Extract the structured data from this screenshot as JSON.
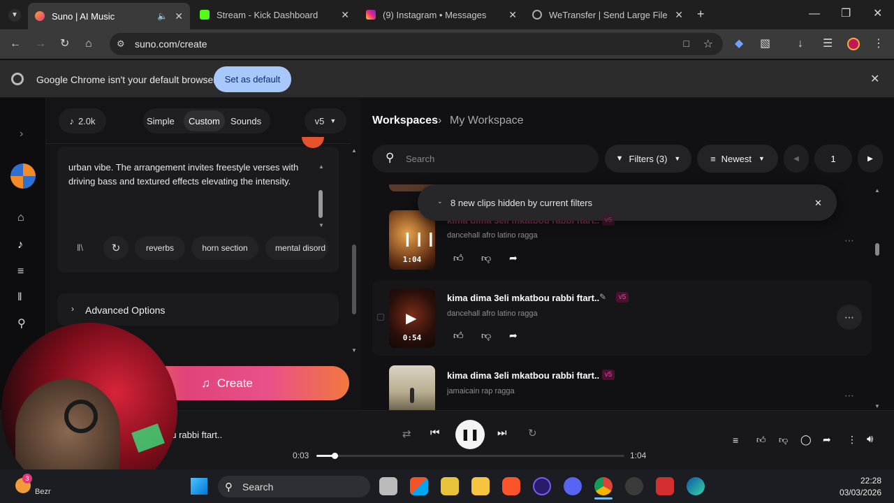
{
  "browser": {
    "tabs": [
      {
        "title": "Suno | AI Music",
        "color": "#f06a3b"
      },
      {
        "title": "Stream - Kick Dashboard",
        "color": "#53fc18"
      },
      {
        "title": "(9) Instagram • Messages",
        "color": "#d6249f"
      },
      {
        "title": "WeTransfer | Send Large Files Fa",
        "color": "#8a8a8a"
      }
    ],
    "url": "suno.com/create",
    "infobar_text": "Google Chrome isn't your default browser",
    "set_default_label": "Set as default"
  },
  "left_panel": {
    "credits": "2.0k",
    "modes": [
      "Simple",
      "Custom",
      "Sounds"
    ],
    "active_mode": "Custom",
    "version": "v5",
    "style_text": "urban vibe. The arrangement invites freestyle verses with driving bass and textured effects elevating the intensity.",
    "chips": [
      "reverbs",
      "horn section",
      "mental disord"
    ],
    "advanced_label": "Advanced Options",
    "create_label": "Create"
  },
  "workspace": {
    "breadcrumb_root": "Workspaces",
    "breadcrumb_current": "My Workspace",
    "search_placeholder": "Search",
    "filters_label": "Filters (3)",
    "sort_label": "Newest",
    "page": "1",
    "notice": "8 new clips hidden by current filters",
    "songs": [
      {
        "title": "kima dima 3eli mkatbou rabbi ftart..",
        "style": "dancehall afro latino ragga",
        "duration": "1:04",
        "version": "v5"
      },
      {
        "title": "kima dima 3eli mkatbou rabbi ftart..",
        "style": "dancehall afro latino ragga",
        "duration": "0:54",
        "version": "v5"
      },
      {
        "title": "kima dima 3eli mkatbou rabbi ftart..",
        "style": "jamaicain rap ragga",
        "duration": "",
        "version": "v5"
      }
    ]
  },
  "player": {
    "title": "ou rabbi ftart..",
    "elapsed": "0:03",
    "total": "1:04",
    "progress": 0.06
  },
  "taskbar": {
    "search_label": "Search",
    "time": "22:28",
    "date": "03/03/2026",
    "weather_label": "Bezr",
    "notification_count": "3"
  }
}
